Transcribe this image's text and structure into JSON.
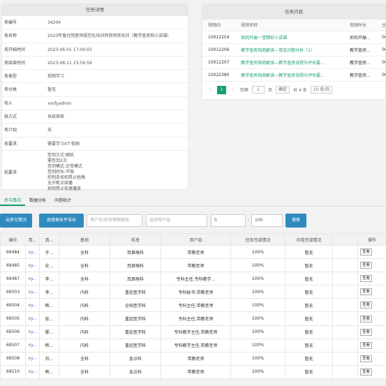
{
  "detail": {
    "title": "任务详情",
    "rows": [
      {
        "k": "务编号",
        "v": "34204"
      },
      {
        "k": "务名称",
        "v": "2023年度住院医师规范化培训师资师资培训（教学查房和小讲课）"
      },
      {
        "k": "务开始时间",
        "v": "2023-06-01 17:04:03"
      },
      {
        "k": "务结束时间",
        "v": "2023-08-11 23:59:59"
      },
      {
        "k": "务类型",
        "v": "视频学习"
      },
      {
        "k": "务分类",
        "v": "暂无"
      },
      {
        "k": "布人",
        "v": "xxsfyadmin"
      },
      {
        "k": "核方式",
        "v": "系统审核"
      },
      {
        "k": "务介绍",
        "v": "无"
      },
      {
        "k": "务要求",
        "v": "需要学习4个视频"
      }
    ],
    "multi": {
      "k": "前要求",
      "lines": [
        "签到方式:随机",
        "需签到2次",
        "签到模式:正常模式",
        "签到时长:不限",
        "控制条如何禁止拖拽",
        "允许断点续播",
        "如何禁止倍速播放"
      ]
    }
  },
  "content": {
    "title": "任务内容",
    "headers": [
      "视频ID",
      "视频名称",
      "视频时长",
      "主讲"
    ],
    "rows": [
      {
        "id": "10012204",
        "name": "如何开展一堂精彩小讲课",
        "dur": "如何开展...",
        "sp": "00:33"
      },
      {
        "id": "10012206",
        "name": "教学查房指南解读—常见问题分析（1）",
        "dur": "教学查房...",
        "sp": "00:35"
      },
      {
        "id": "10012207",
        "name": "教学查房指南解读—教学查房流程与评估要...",
        "dur": "教学查房...",
        "sp": "00:36"
      },
      {
        "id": "10022380",
        "name": "教学查房指南解读—教学查房流程与评估要...",
        "dur": "教学查房...",
        "sp": "00:33"
      }
    ],
    "pager": {
      "prev": "‹",
      "page": "1",
      "next": "›",
      "goto_label": "到第",
      "goto_value": "1",
      "page_unit": "页",
      "confirm": "确定",
      "total": "共 4 条",
      "size": "10 条/页"
    }
  },
  "tabs": [
    {
      "label": "参与情况",
      "active": true
    },
    {
      "label": "数据分析",
      "active": false
    },
    {
      "label": "问卷统计",
      "active": false
    }
  ],
  "toolbar": {
    "export_btn": "出参与情况",
    "export_cond_btn": "按搜索条件导出",
    "search_placeholder": "用户名/姓名模糊搜索",
    "group_placeholder": "选择用户组",
    "min_value": "0",
    "dash": "-",
    "max_value": "100",
    "search_btn": "搜索"
  },
  "table": {
    "headers": [
      "编号",
      "用...",
      "真...",
      "基地",
      "科室",
      "用户组",
      "任务完成情况",
      "问卷完成情况",
      "",
      "操作"
    ],
    "op_label": "查看",
    "rows": [
      {
        "id": "69484",
        "user": "xy...",
        "name": "于...",
        "base": "全科",
        "dept": "耳鼻喉科",
        "group": "带教老师",
        "task": "100%",
        "survey": "暂无"
      },
      {
        "id": "69485",
        "user": "xy...",
        "name": "史...",
        "base": "全科",
        "dept": "耳鼻喉科",
        "group": "带教老师",
        "task": "100%",
        "survey": "暂无"
      },
      {
        "id": "69487",
        "user": "xy...",
        "name": "李...",
        "base": "全科",
        "dept": "耳鼻喉科",
        "group": "专科主任,专科教学...",
        "task": "100%",
        "survey": "暂无"
      },
      {
        "id": "69503",
        "user": "xy...",
        "name": "李...",
        "base": "内科",
        "dept": "重症医学科",
        "group": "专科秘书,带教老师",
        "task": "100%",
        "survey": "暂无"
      },
      {
        "id": "69504",
        "user": "xy...",
        "name": "韩...",
        "base": "内科",
        "dept": "全科医学科",
        "group": "专科主任,带教老师",
        "task": "100%",
        "survey": "暂无"
      },
      {
        "id": "69505",
        "user": "xy...",
        "name": "张...",
        "base": "内科",
        "dept": "重症医学科",
        "group": "专科主任,带教老师",
        "task": "100%",
        "survey": "暂无"
      },
      {
        "id": "69506",
        "user": "xy...",
        "name": "鄧...",
        "base": "内科",
        "dept": "重症医学科",
        "group": "专科教学主任,带教老师",
        "task": "100%",
        "survey": "暂无"
      },
      {
        "id": "69507",
        "user": "xy...",
        "name": "韩...",
        "base": "内科",
        "dept": "重症医学科",
        "group": "专科教学主任,带教老师",
        "task": "100%",
        "survey": "暂无"
      },
      {
        "id": "69508",
        "user": "xy...",
        "name": "刘...",
        "base": "全科",
        "dept": "急诊科",
        "group": "带教老师",
        "task": "100%",
        "survey": "暂无"
      },
      {
        "id": "69510",
        "user": "xy...",
        "name": "韩...",
        "base": "全科",
        "dept": "急诊科",
        "group": "带教老师",
        "task": "100%",
        "survey": "暂无"
      }
    ]
  },
  "colors": {
    "accent": "#1a9e6e",
    "button": "#2f8bbf",
    "link": "#2f6fbf"
  }
}
